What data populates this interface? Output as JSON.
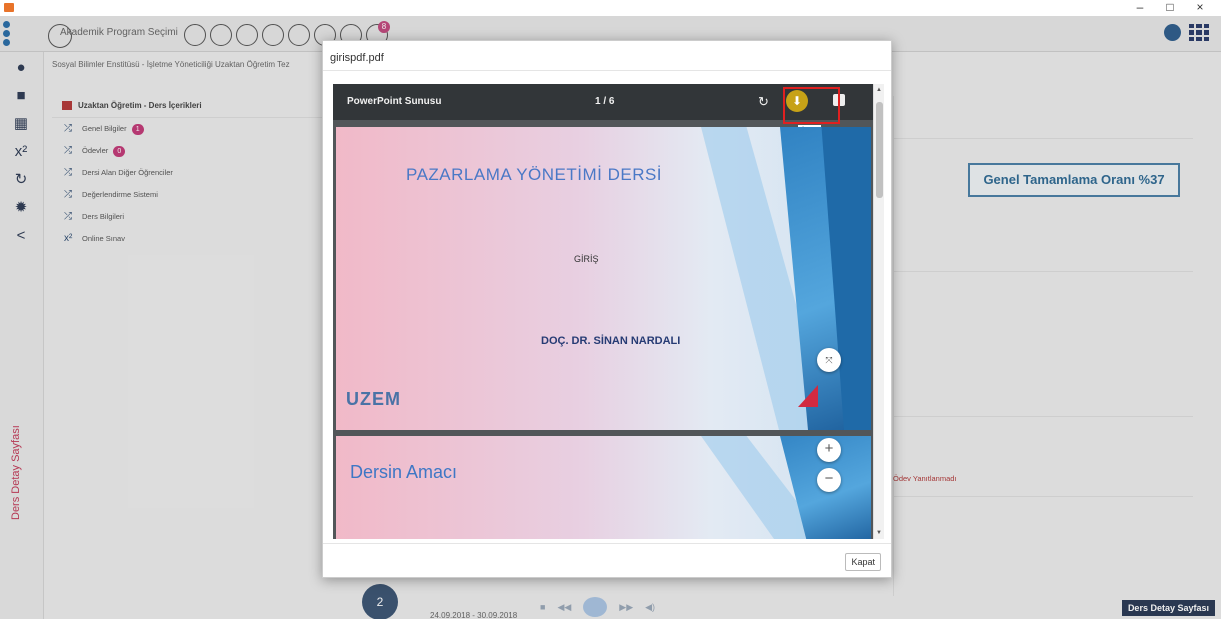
{
  "window": {
    "minimize": "–",
    "maximize": "□",
    "close": "×"
  },
  "nav": {
    "program_select": "Akademik Program Seçimi",
    "badge_count": "8"
  },
  "breadcrumb": "Sosyal Bilimler Enstitüsü - İşletme Yöneticiliği Uzaktan Öğretim Tez",
  "menu": {
    "header": "Uzaktan Öğretim - Ders İçerikleri",
    "items": [
      {
        "label": "Genel Bilgiler",
        "badge": "1",
        "icon": "shuffle-icon"
      },
      {
        "label": "Ödevler",
        "badge": "0",
        "icon": "shuffle-icon"
      },
      {
        "label": "Dersi Alan Diğer Öğrenciler",
        "badge": "",
        "icon": "shuffle-icon"
      },
      {
        "label": "Değerlendirme Sistemi",
        "badge": "",
        "icon": "shuffle-icon"
      },
      {
        "label": "Ders Bilgileri",
        "badge": "",
        "icon": "shuffle-icon"
      },
      {
        "label": "Online Sınav",
        "badge": "",
        "icon": "superscript-icon"
      }
    ]
  },
  "leftbar": {
    "vertical_label": "Ders Detay Sayfası"
  },
  "right": {
    "completion": "Genel Tamamlama Oranı %37",
    "odev_status": "Ödev Yanıtlanmadı"
  },
  "bottom": {
    "step": "2",
    "date": "24.09.2018 - 30.09.2018",
    "detail_button": "Ders Detay Sayfası"
  },
  "modal": {
    "title": "girispdf.pdf",
    "close_button": "Kapat",
    "viewer": {
      "doc_title": "PowerPoint Sunusu",
      "page_indicator": "1 / 6",
      "download_tooltip": "İndir"
    },
    "slide1": {
      "title": "PAZARLAMA YÖNETİMİ DERSİ",
      "subtitle": "GİRİŞ",
      "author": "DOÇ. DR. SİNAN NARDALI",
      "logo_text": "UZEM"
    },
    "slide2": {
      "title": "Dersin Amacı"
    }
  },
  "colors": {
    "accent": "#2f6b94",
    "highlight": "#e02020",
    "download_button": "#c7a217",
    "toolbar": "#323639"
  }
}
